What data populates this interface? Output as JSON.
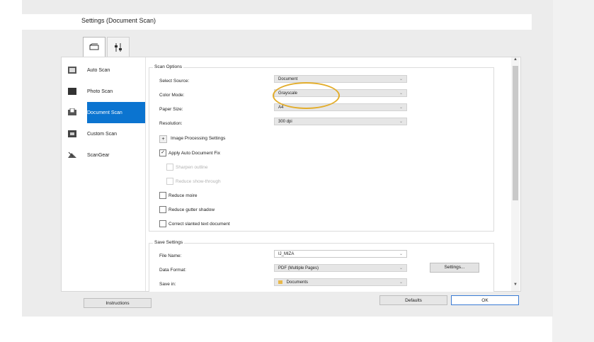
{
  "window": {
    "title": "Settings (Document Scan)"
  },
  "tabs": [
    {
      "icon": "scan-tab-icon",
      "active": true
    },
    {
      "icon": "general-settings-tab-icon",
      "active": false
    }
  ],
  "sidebar": {
    "items": [
      {
        "label": "Auto Scan",
        "icon": "auto-scan-icon"
      },
      {
        "label": "Photo Scan",
        "icon": "photo-scan-icon"
      },
      {
        "label": "Document Scan",
        "icon": "document-scan-icon",
        "active": true
      },
      {
        "label": "Custom Scan",
        "icon": "custom-scan-icon"
      },
      {
        "label": "ScanGear",
        "icon": "scangear-icon"
      }
    ]
  },
  "scan_options": {
    "legend": "Scan Options",
    "select_source": {
      "label": "Select Source:",
      "value": "Document"
    },
    "color_mode": {
      "label": "Color Mode:",
      "value": "Grayscale"
    },
    "paper_size": {
      "label": "Paper Size:",
      "value": "A4"
    },
    "resolution": {
      "label": "Resolution:",
      "value": "300 dpi"
    },
    "image_processing": {
      "toggle": "+",
      "label": "Image Processing Settings"
    },
    "checks": [
      {
        "label": "Apply Auto Document Fix",
        "checked": true,
        "disabled": false
      },
      {
        "label": "Sharpen outline",
        "checked": false,
        "disabled": true
      },
      {
        "label": "Reduce show-through",
        "checked": false,
        "disabled": true
      },
      {
        "label": "Reduce moire",
        "checked": false,
        "disabled": false
      },
      {
        "label": "Reduce gutter shadow",
        "checked": false,
        "disabled": false
      },
      {
        "label": "Correct slanted text document",
        "checked": false,
        "disabled": false
      }
    ]
  },
  "save_settings": {
    "legend": "Save Settings",
    "file_name": {
      "label": "File Name:",
      "value": "IJ_MIZA"
    },
    "data_format": {
      "label": "Data Format:",
      "value": "PDF (Multiple Pages)",
      "settings_button": "Settings..."
    },
    "save_in": {
      "label": "Save in:",
      "value": "Documents"
    }
  },
  "footer": {
    "instructions": "Instructions",
    "defaults": "Defaults",
    "ok": "OK"
  },
  "colors": {
    "accent": "#0b74d0",
    "highlight": "#e3ad2b"
  }
}
